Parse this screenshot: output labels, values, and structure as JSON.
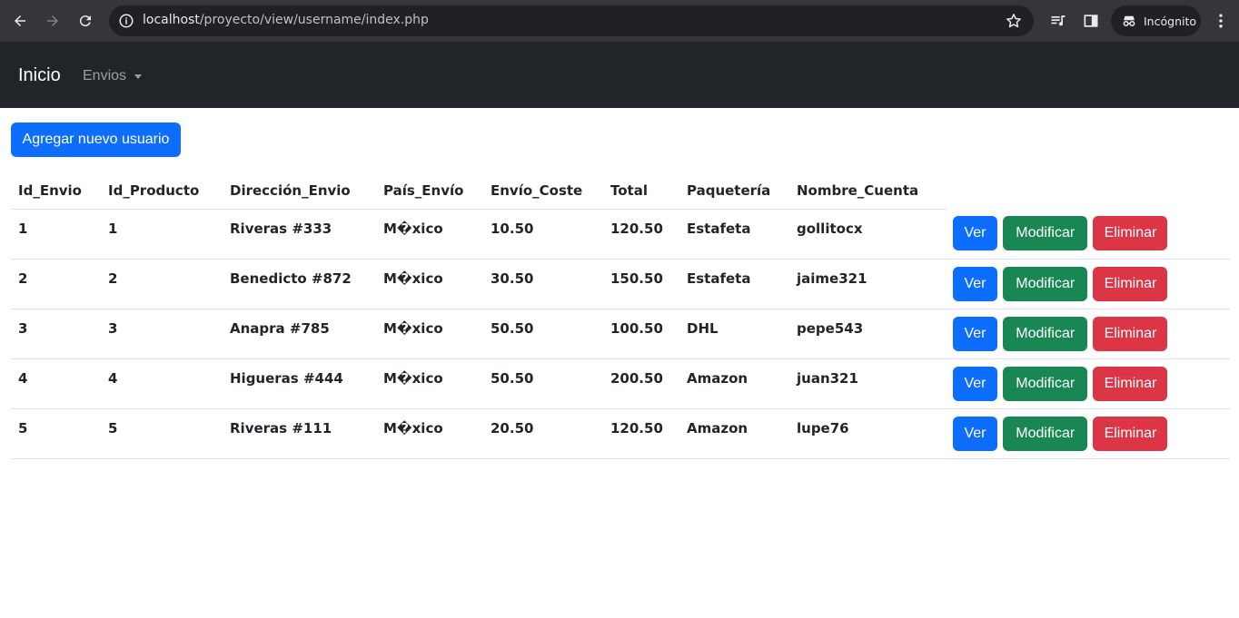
{
  "browser": {
    "url_host": "localhost",
    "url_path": "/proyecto/view/username/index.php",
    "incognito_label": "Incógnito"
  },
  "navbar": {
    "brand": "Inicio",
    "dropdown_label": "Envios"
  },
  "content": {
    "add_button_label": "Agregar nuevo usuario"
  },
  "table": {
    "headers": [
      "Id_Envio",
      "Id_Producto",
      "Dirección_Envio",
      "País_Envío",
      "Envío_Coste",
      "Total",
      "Paquetería",
      "Nombre_Cuenta"
    ],
    "action_labels": {
      "view": "Ver",
      "edit": "Modificar",
      "delete": "Eliminar"
    },
    "rows": [
      [
        "1",
        "1",
        "Riveras #333",
        "M�xico",
        "10.50",
        "120.50",
        "Estafeta",
        "gollitocx"
      ],
      [
        "2",
        "2",
        "Benedicto #872",
        "M�xico",
        "30.50",
        "150.50",
        "Estafeta",
        "jaime321"
      ],
      [
        "3",
        "3",
        "Anapra #785",
        "M�xico",
        "50.50",
        "100.50",
        "DHL",
        "pepe543"
      ],
      [
        "4",
        "4",
        "Higueras #444",
        "M�xico",
        "50.50",
        "200.50",
        "Amazon",
        "juan321"
      ],
      [
        "5",
        "5",
        "Riveras #111",
        "M�xico",
        "20.50",
        "120.50",
        "Amazon",
        "lupe76"
      ]
    ]
  },
  "colors": {
    "primary": "#0d6efd",
    "success": "#198754",
    "danger": "#dc3545",
    "navbar": "#212529",
    "chrome": "#35363a"
  }
}
